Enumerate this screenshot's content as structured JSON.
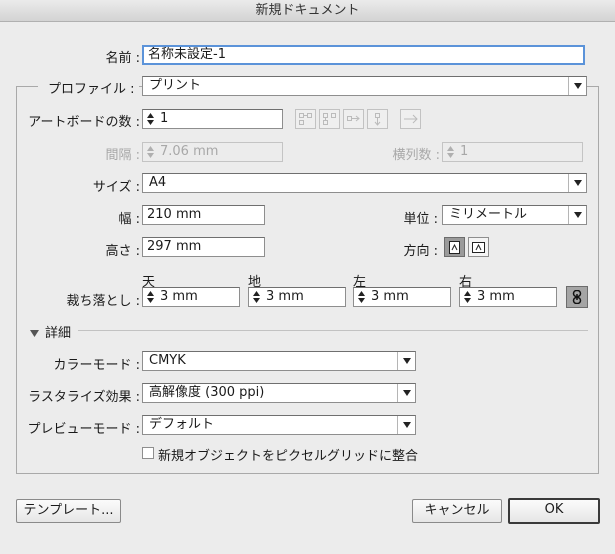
{
  "window": {
    "title": "新規ドキュメント"
  },
  "name": {
    "label": "名前 :",
    "value": "名称未設定-1"
  },
  "profile": {
    "label": "プロファイル :",
    "value": "プリント"
  },
  "artboards": {
    "label": "アートボードの数 :",
    "value": "1"
  },
  "spacing": {
    "label": "間隔 :",
    "value": "7.06 mm"
  },
  "columns": {
    "label": "横列数 :",
    "value": "1"
  },
  "size": {
    "label": "サイズ :",
    "value": "A4"
  },
  "width": {
    "label": "幅 :",
    "value": "210 mm"
  },
  "units": {
    "label": "単位 :",
    "value": "ミリメートル"
  },
  "height": {
    "label": "高さ :",
    "value": "297 mm"
  },
  "orientation": {
    "label": "方向 :",
    "selected": "portrait"
  },
  "bleed": {
    "label": "裁ち落とし :",
    "top": {
      "label": "天",
      "value": "3 mm"
    },
    "bottom": {
      "label": "地",
      "value": "3 mm"
    },
    "left": {
      "label": "左",
      "value": "3 mm"
    },
    "right": {
      "label": "右",
      "value": "3 mm"
    }
  },
  "advanced": {
    "label": "詳細"
  },
  "color_mode": {
    "label": "カラーモード :",
    "value": "CMYK"
  },
  "raster": {
    "label": "ラスタライズ効果 :",
    "value": "高解像度 (300 ppi)"
  },
  "preview": {
    "label": "プレビューモード :",
    "value": "デフォルト"
  },
  "align_pixel": {
    "label": "新規オブジェクトをピクセルグリッドに整合",
    "checked": false
  },
  "buttons": {
    "templates": "テンプレート...",
    "cancel": "キャンセル",
    "ok": "OK"
  }
}
